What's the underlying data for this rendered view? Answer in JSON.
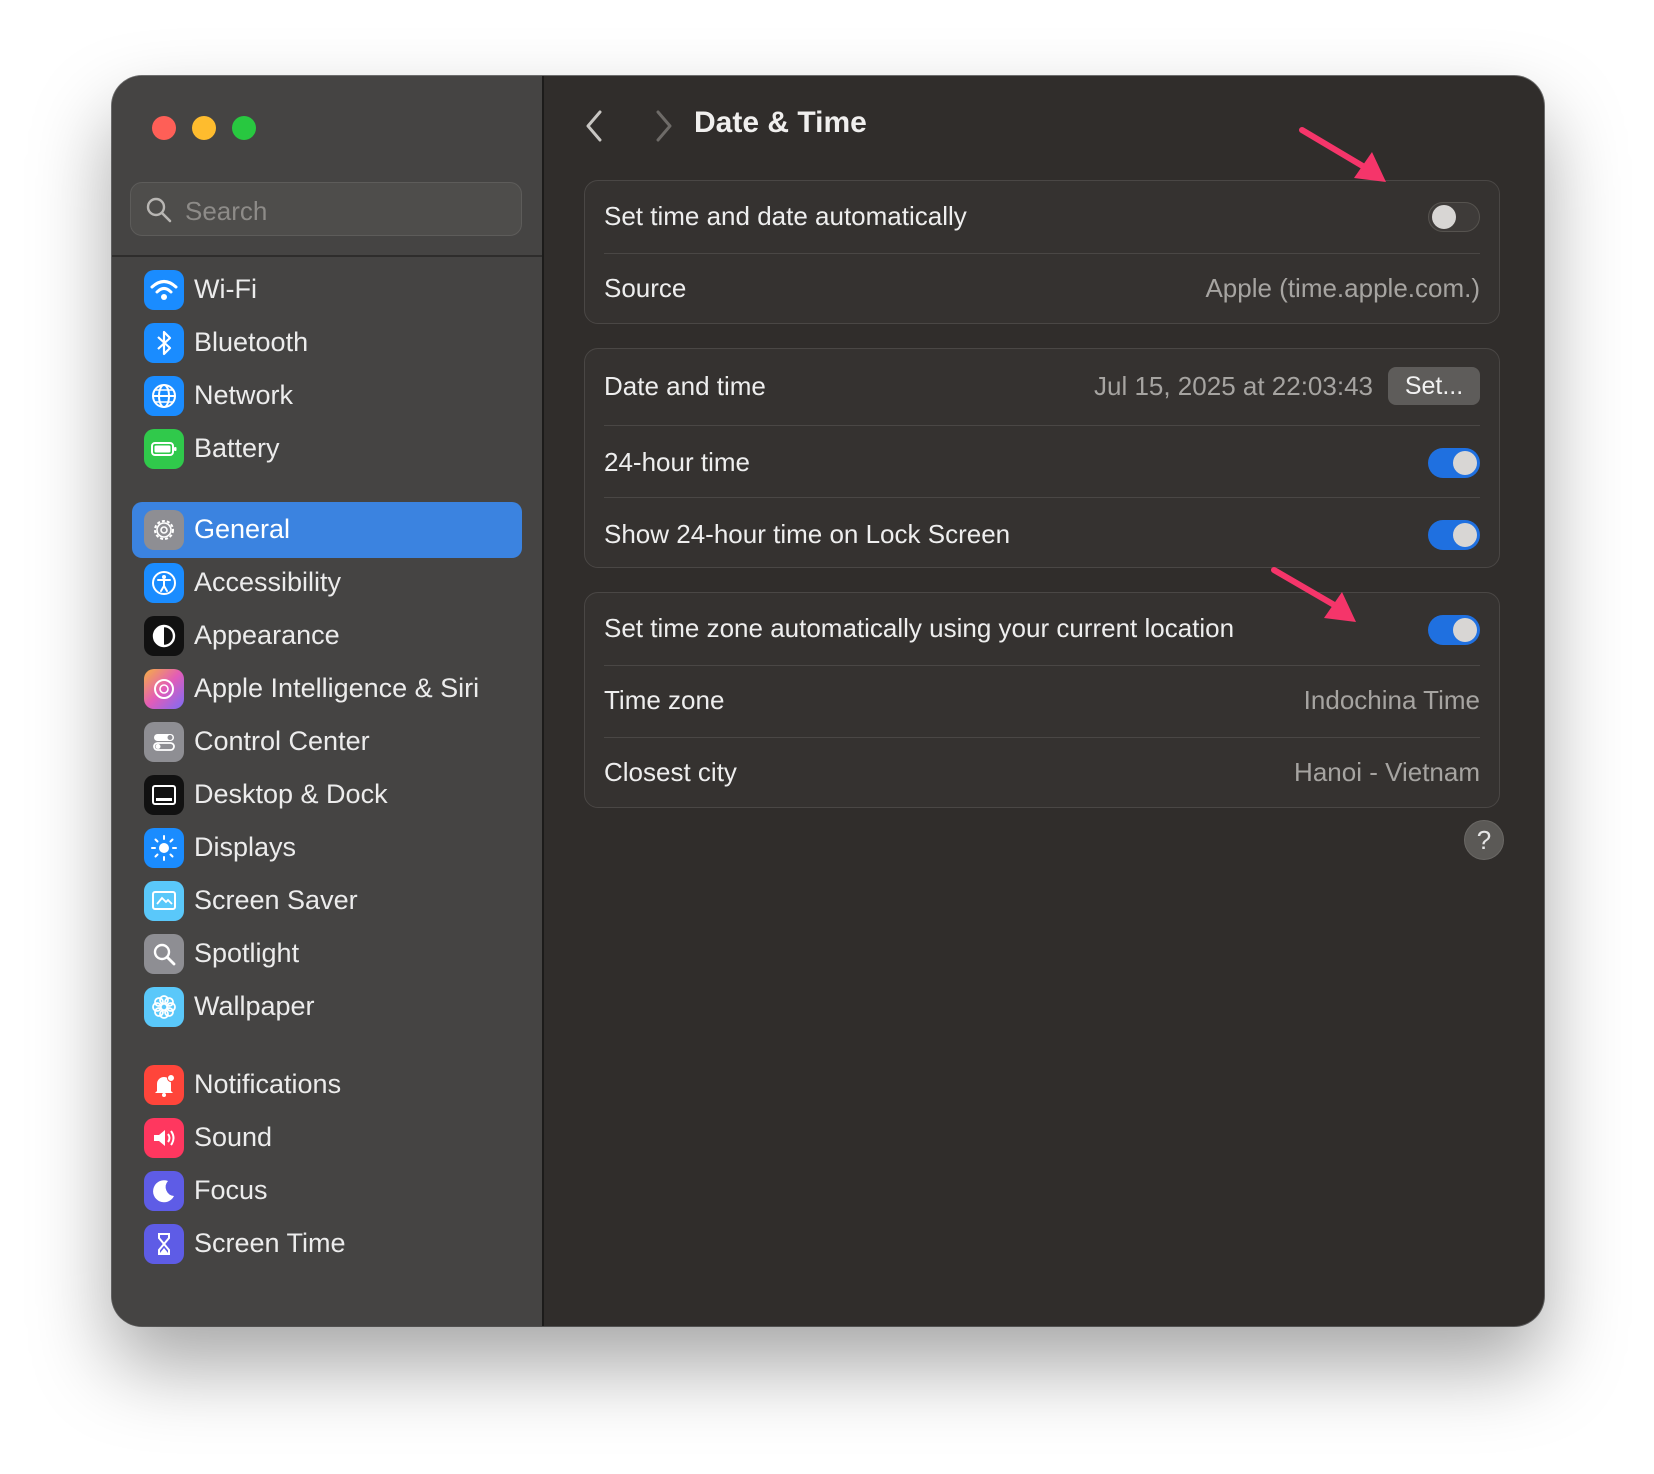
{
  "window": {
    "title": "Date & Time"
  },
  "sidebar": {
    "search_placeholder": "Search",
    "selected": "General",
    "items": [
      {
        "label": "Wi-Fi",
        "icon": "wifi-icon",
        "color": "#1a8cff"
      },
      {
        "label": "Bluetooth",
        "icon": "bluetooth-icon",
        "color": "#1a8cff"
      },
      {
        "label": "Network",
        "icon": "globe-icon",
        "color": "#1a8cff"
      },
      {
        "label": "Battery",
        "icon": "battery-icon",
        "color": "#30c94b"
      },
      {
        "label": "General",
        "icon": "gear-icon",
        "color": "#8e8e93"
      },
      {
        "label": "Accessibility",
        "icon": "accessibility-icon",
        "color": "#1a8cff"
      },
      {
        "label": "Appearance",
        "icon": "appearance-icon",
        "color": "#111111"
      },
      {
        "label": "Apple Intelligence & Siri",
        "icon": "siri-icon",
        "color": "#e25cb8"
      },
      {
        "label": "Control Center",
        "icon": "toggles-icon",
        "color": "#8e8e93"
      },
      {
        "label": "Desktop & Dock",
        "icon": "dock-icon",
        "color": "#111111"
      },
      {
        "label": "Displays",
        "icon": "sun-icon",
        "color": "#1a8cff"
      },
      {
        "label": "Screen Saver",
        "icon": "screen-saver-icon",
        "color": "#5ac8fa"
      },
      {
        "label": "Spotlight",
        "icon": "magnifier-icon",
        "color": "#8e8e93"
      },
      {
        "label": "Wallpaper",
        "icon": "flower-icon",
        "color": "#5ac8fa"
      },
      {
        "label": "Notifications",
        "icon": "bell-icon",
        "color": "#ff453a"
      },
      {
        "label": "Sound",
        "icon": "speaker-icon",
        "color": "#ff375f"
      },
      {
        "label": "Focus",
        "icon": "moon-icon",
        "color": "#5e5ce6"
      },
      {
        "label": "Screen Time",
        "icon": "hourglass-icon",
        "color": "#5e5ce6"
      }
    ]
  },
  "groups": {
    "auto": {
      "set_auto_label": "Set time and date automatically",
      "set_auto_on": false,
      "source_label": "Source",
      "source_value": "Apple (time.apple.com.)"
    },
    "datetime": {
      "date_label": "Date and time",
      "date_value": "Jul 15, 2025 at 22:03:43",
      "set_button": "Set...",
      "h24_label": "24-hour time",
      "h24_on": true,
      "lock_label": "Show 24-hour time on Lock Screen",
      "lock_on": true
    },
    "timezone": {
      "auto_tz_label": "Set time zone automatically using your current location",
      "auto_tz_on": true,
      "tz_label": "Time zone",
      "tz_value": "Indochina Time",
      "city_label": "Closest city",
      "city_value": "Hanoi - Vietnam"
    }
  },
  "help": "?",
  "colors": {
    "accent": "#1f70e0",
    "selection": "#3b83e0",
    "annotation_arrow": "#f5356a"
  }
}
